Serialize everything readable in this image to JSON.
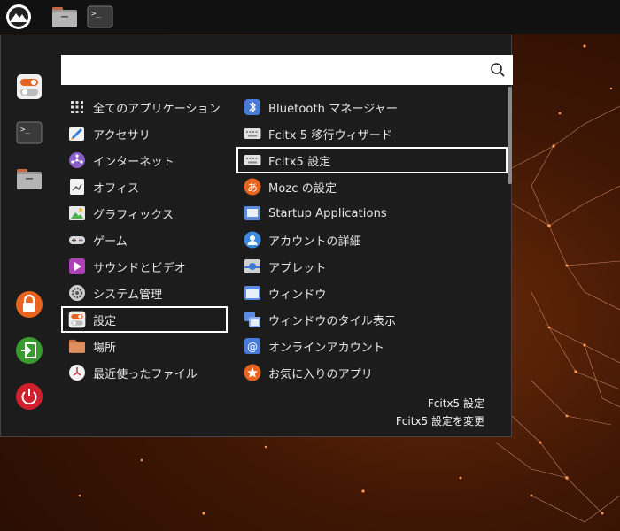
{
  "search": {
    "value": "",
    "placeholder": ""
  },
  "categories": [
    {
      "label": "全てのアプリケーション",
      "icon": "grid-icon"
    },
    {
      "label": "アクセサリ",
      "icon": "accessories-icon"
    },
    {
      "label": "インターネット",
      "icon": "internet-icon"
    },
    {
      "label": "オフィス",
      "icon": "office-icon"
    },
    {
      "label": "グラフィックス",
      "icon": "graphics-icon"
    },
    {
      "label": "ゲーム",
      "icon": "gamepad-icon"
    },
    {
      "label": "サウンドとビデオ",
      "icon": "multimedia-icon"
    },
    {
      "label": "システム管理",
      "icon": "system-gear-icon"
    },
    {
      "label": "設定",
      "icon": "settings-toggle-icon"
    },
    {
      "label": "場所",
      "icon": "folder-icon"
    },
    {
      "label": "最近使ったファイル",
      "icon": "recent-clock-icon"
    }
  ],
  "apps": [
    {
      "label": "Bluetooth マネージャー",
      "icon": "bluetooth-icon"
    },
    {
      "label": "Fcitx 5 移行ウィザード",
      "icon": "keyboard-icon"
    },
    {
      "label": "Fcitx5 設定",
      "icon": "keyboard-icon"
    },
    {
      "label": "Mozc の設定",
      "icon": "mozc-icon"
    },
    {
      "label": "Startup Applications",
      "icon": "startup-icon"
    },
    {
      "label": "アカウントの詳細",
      "icon": "user-account-icon"
    },
    {
      "label": "アプレット",
      "icon": "applet-icon"
    },
    {
      "label": "ウィンドウ",
      "icon": "window-icon"
    },
    {
      "label": "ウィンドウのタイル表示",
      "icon": "window-tile-icon"
    },
    {
      "label": "オンラインアカウント",
      "icon": "online-accounts-icon"
    },
    {
      "label": "お気に入りのアプリ",
      "icon": "star-icon"
    }
  ],
  "description": {
    "title": "Fcitx5 設定",
    "text": "Fcitx5 設定を変更"
  },
  "colors": {
    "accent_orange": "#e8641e",
    "power_red": "#d0202e",
    "logout_green": "#3a9a30"
  }
}
